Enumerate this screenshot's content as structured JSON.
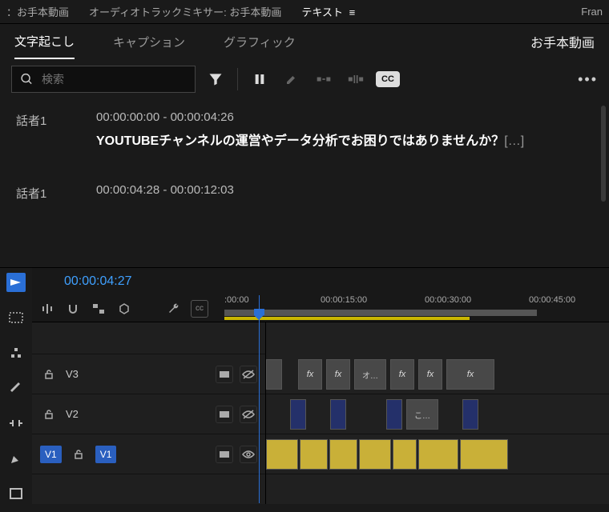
{
  "topTabs": {
    "seq": "：お手本動画",
    "mixer": "オーディオトラックミキサー: お手本動画",
    "text": "テキスト",
    "fran": "Fran"
  },
  "subTabs": {
    "transcribe": "文字起こし",
    "caption": "キャプション",
    "graphic": "グラフィック",
    "rightTitle": "お手本動画"
  },
  "search": {
    "placeholder": "検索"
  },
  "cc": "CC",
  "transcript": [
    {
      "speaker": "話者1",
      "time": "00:00:00:00 - 00:00:04:26",
      "text": "YOUTUBEチャンネルの運営やデータ分析でお困りではありませんか？",
      "ellipsis": "[…]"
    },
    {
      "speaker": "話者1",
      "time": "00:00:04:28 - 00:00:12:03",
      "text": ""
    }
  ],
  "timeline": {
    "timecode": "00:00:04:27",
    "ruler": [
      ":00:00",
      "00:00:15:00",
      "00:00:30:00",
      "00:00:45:00"
    ],
    "tracks": {
      "v3": "V3",
      "v2": "V2",
      "v1": "V1",
      "v1chip": "V1"
    },
    "clipLabels": {
      "fx": "fx",
      "o": "オ…",
      "ko": "こ…"
    }
  }
}
